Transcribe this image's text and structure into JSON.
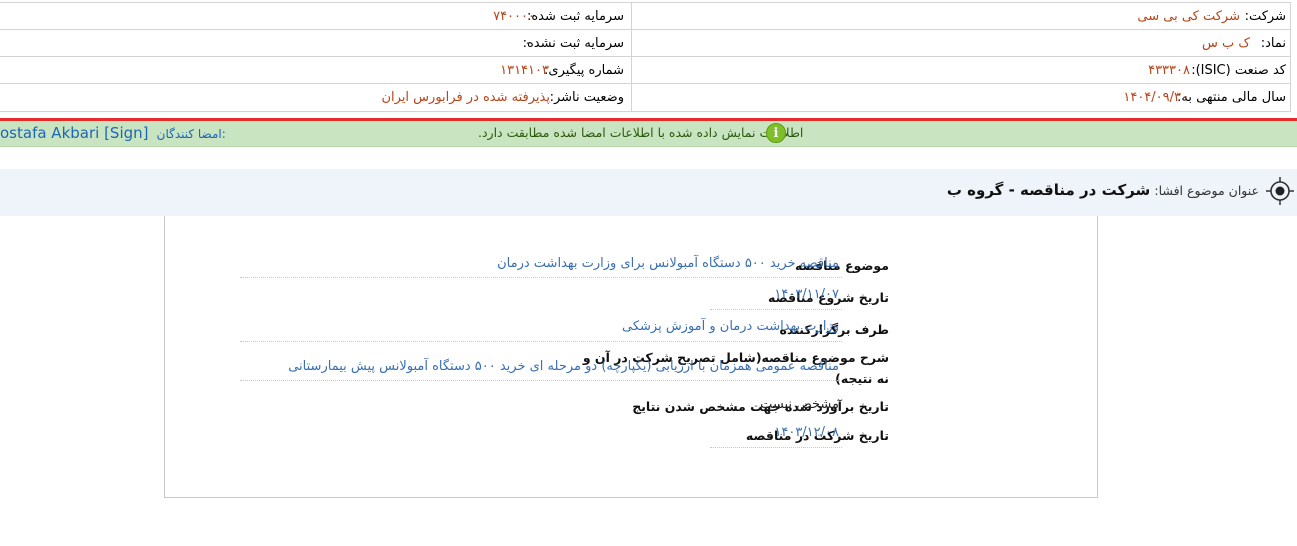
{
  "header_info": {
    "company_label": "شرکت:",
    "company_value": "شرکت کی بی سی",
    "symbol_label": "نماد:",
    "symbol_value": "ک ب س",
    "isic_label": "کد صنعت (ISIC):",
    "isic_value": "۴۳۳۳۰۸",
    "fiscal_year_label": "سال مالی منتهی به:",
    "fiscal_year_value": "۱۴۰۴/۰۹/۳۰",
    "registered_capital_label": "سرمایه ثبت شده:",
    "registered_capital_value": "۷۴۰۰۰۰",
    "unregistered_capital_label": "سرمایه ثبت نشده:",
    "unregistered_capital_value": "۰",
    "tracking_number_label": "شماره پیگیری:",
    "tracking_number_value": "۱۳۱۴۱۰۳",
    "publisher_status_label": "وضعیت ناشر:",
    "publisher_status_value": "پذیرفته شده در فرابورس ایران"
  },
  "signature_bar": {
    "signers_label": "امضا کنندگان:",
    "signers_value": "ostafa Akbari [Sign]",
    "notice": "اطلاعات نمایش داده شده با اطلاعات امضا شده مطابقت دارد.",
    "info_icon_glyph": "i",
    "accent_color": "#7fbf28"
  },
  "disclosure": {
    "subject_label": "عنوان موضوع افشا:",
    "subject_value": "شرکت در مناقصه - گروه ب"
  },
  "details": [
    {
      "label": "موضوع مناقصه",
      "value": "مناقصه خرید ۵۰۰ دستگاه آمبولانس برای وزارت بهداشت درمان"
    },
    {
      "label": "تاریخ شروع مناقصه",
      "value": "۱۴۰۳/۱۱/۰۷"
    },
    {
      "label": "طرف برگزارکننده",
      "value": "وزارت بهداشت درمان و آموزش پزشکی"
    },
    {
      "label_line1": "شرح موضوع مناقصه(شامل تصریح شرکت در آن و",
      "label_line2": "نه نتیجه)",
      "value": "مناقصه عمومی همزمان با ارزیابی (یکپارچه) دو مرحله ای خرید ۵۰۰ دستگاه آمبولانس پیش بیمارستانی"
    },
    {
      "label": "تاریخ برآورد شده جهت مشخص شدن نتایج",
      "value": "مشخص نیست"
    },
    {
      "label": "تاریخ شرکت در مناقصه",
      "value": "۱۴۰۳/۱۲/۰۸"
    }
  ]
}
